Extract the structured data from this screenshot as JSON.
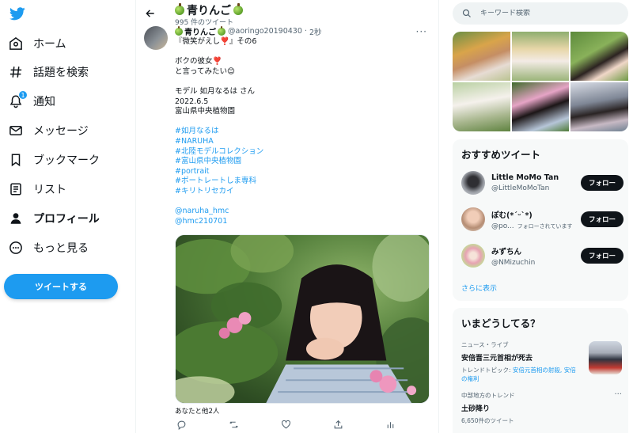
{
  "nav": {
    "items": [
      {
        "label": "ホーム",
        "icon": "home-icon"
      },
      {
        "label": "話題を検索",
        "icon": "hashtag-icon"
      },
      {
        "label": "通知",
        "icon": "bell-icon",
        "badge": "1"
      },
      {
        "label": "メッセージ",
        "icon": "mail-icon"
      },
      {
        "label": "ブックマーク",
        "icon": "bookmark-icon"
      },
      {
        "label": "リスト",
        "icon": "list-icon"
      },
      {
        "label": "プロフィール",
        "icon": "person-icon",
        "active": true
      },
      {
        "label": "もっと見る",
        "icon": "more-circle-icon"
      }
    ],
    "tweet_button": "ツイートする",
    "brand_color": "#1d9bf0"
  },
  "header": {
    "profile_name": "青りんご",
    "tweet_count": "995 件のツイート"
  },
  "tweet": {
    "display_name": "青りんご",
    "handle": "@aoringo20190430",
    "separator": "·",
    "time": "2秒",
    "lines": [
      "『微笑がえし❣️』その6",
      "",
      "ボクの彼女❣️",
      "と言ってみたい😊",
      "",
      "モデル 如月なるは さん",
      "2022.6.5",
      "富山県中央植物園",
      "",
      "#如月なるは",
      "#NARUHA",
      "#北陸モデルコレクション",
      "#富山県中央植物園",
      "#portrait",
      "#ポートレートしま専科",
      "#キリトリセカイ",
      "",
      "@naruha_hmc",
      "@hmc210701"
    ],
    "tagged": "あなたと他2人"
  },
  "search": {
    "placeholder": "キーワード検索"
  },
  "recommend": {
    "title": "おすすめツイート",
    "users": [
      {
        "name": "Little MoMo Tan",
        "handle": "@LittleMoMoTan",
        "follows_you": "",
        "button": "フォロー"
      },
      {
        "name": "ぽむ(*´ᵕ`*)",
        "handle": "@po...",
        "follows_you": "フォローされています",
        "button": "フォロー"
      },
      {
        "name": "みずちん",
        "handle": "@NMizuchin",
        "follows_you": "",
        "button": "フォロー"
      }
    ],
    "show_more": "さらに表示"
  },
  "trends": {
    "title": "いまどうしてる？",
    "items": [
      {
        "context": "ニュース・ライブ",
        "title": "安倍晋三元首相が死去",
        "sub_prefix": "トレンドトピック: ",
        "sub_links": "安倍元首相の射殺, 安倍の権利"
      },
      {
        "context": "中部地方のトレンド",
        "title": "土砂降り",
        "sub_prefix": "6,650件のツイート",
        "sub_links": ""
      }
    ]
  }
}
